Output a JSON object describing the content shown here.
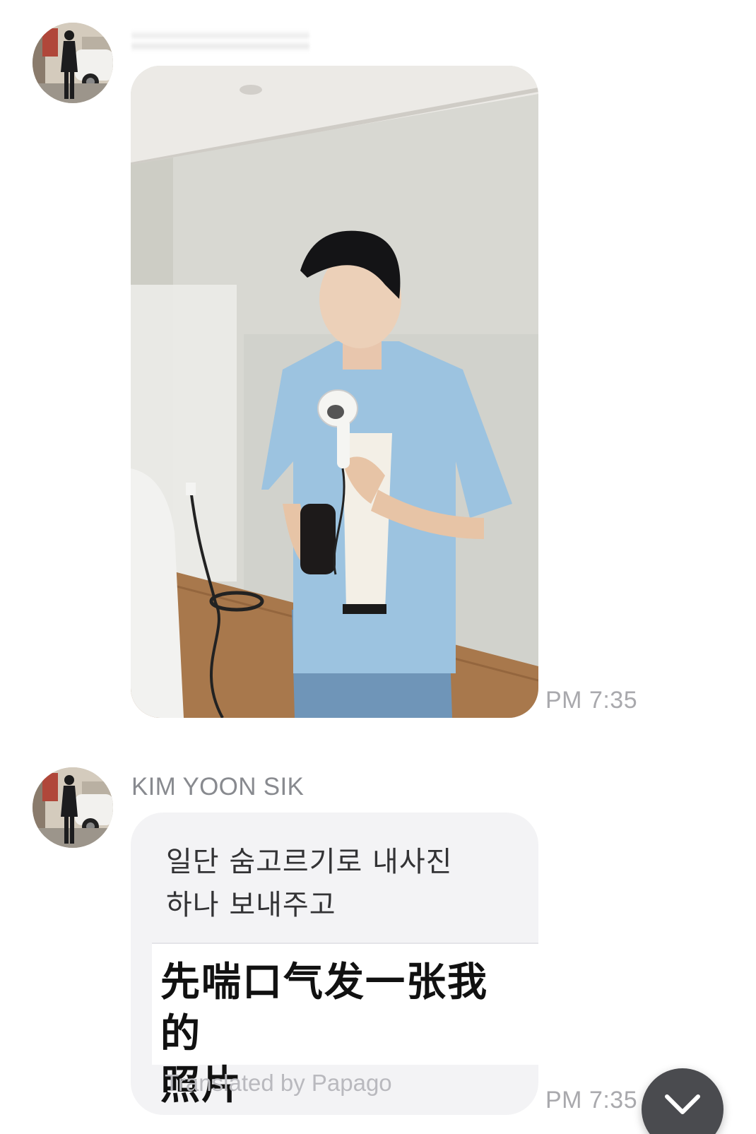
{
  "messages": [
    {
      "type": "photo",
      "sender_name": "",
      "avatar_icon": "profile-photo",
      "time": "PM 7:35"
    },
    {
      "type": "text",
      "sender_name": "KIM YOON SIK",
      "avatar_icon": "profile-photo",
      "text": "일단 숨고르기로 내사진\n하나 보내주고",
      "translation": "先喘口气发一张我的\n照片",
      "translation_credit": "Translated by Papago",
      "time": "PM 7:35"
    }
  ],
  "controls": {
    "scroll_down_icon": "chevron-down-icon"
  },
  "colors": {
    "bubble": "#f3f3f5",
    "meta_text": "#a9a9ad",
    "scroll_button": "#4a4b4f"
  }
}
